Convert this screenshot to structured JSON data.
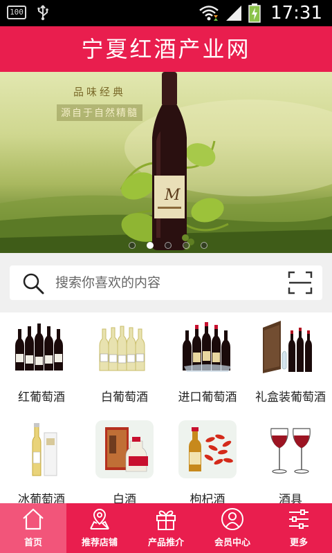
{
  "status_bar": {
    "battery_level": "100",
    "time": "17:31"
  },
  "header": {
    "title": "宁夏红酒产业网"
  },
  "banner": {
    "tagline_1": "品味经典",
    "tagline_2": "源自于自然精髓",
    "bottle_label": "M",
    "slide_count": 5,
    "active_slide": 2
  },
  "search": {
    "placeholder": "搜索你喜欢的内容"
  },
  "categories": [
    {
      "label": "红葡萄酒",
      "icon": "red-wine-bottles"
    },
    {
      "label": "白葡萄酒",
      "icon": "white-wine-bottles"
    },
    {
      "label": "进口葡萄酒",
      "icon": "imported-wine-bottles"
    },
    {
      "label": "礼盒装葡萄酒",
      "icon": "gift-box-wine"
    },
    {
      "label": "冰葡萄酒",
      "icon": "ice-wine-bottle"
    },
    {
      "label": "白酒",
      "icon": "baijiu-bottle"
    },
    {
      "label": "枸杞酒",
      "icon": "goji-wine"
    },
    {
      "label": "酒具",
      "icon": "wine-glasses"
    }
  ],
  "bottom_nav": [
    {
      "label": "首页",
      "icon": "home-icon",
      "active": true
    },
    {
      "label": "推荐店铺",
      "icon": "shop-icon",
      "active": false
    },
    {
      "label": "产品推介",
      "icon": "gift-icon",
      "active": false
    },
    {
      "label": "会员中心",
      "icon": "user-icon",
      "active": false
    },
    {
      "label": "更多",
      "icon": "sliders-icon",
      "active": false
    }
  ],
  "colors": {
    "brand": "#e91e4e",
    "nav_active": "#f2557a"
  }
}
